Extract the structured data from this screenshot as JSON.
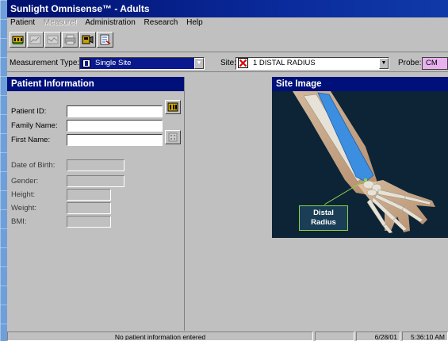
{
  "window": {
    "title": "Sunlight Omnisense™ - Adults"
  },
  "menu": {
    "items": [
      {
        "label": "Patient",
        "enabled": true
      },
      {
        "label": "Measure!",
        "enabled": false
      },
      {
        "label": "Administration",
        "enabled": true
      },
      {
        "label": "Research",
        "enabled": true
      },
      {
        "label": "Help",
        "enabled": true
      }
    ]
  },
  "toolbar": {
    "buttons": [
      {
        "icon": "measure-device-icon",
        "enabled": true
      },
      {
        "icon": "chart-icon",
        "enabled": false
      },
      {
        "icon": "chart-icon",
        "enabled": false
      },
      {
        "icon": "printer-icon",
        "enabled": false
      },
      {
        "icon": "probe-icon",
        "enabled": true
      },
      {
        "icon": "report-icon",
        "enabled": true
      }
    ]
  },
  "selectors": {
    "measurement_type_label": "Measurement Type:",
    "measurement_type_value": "Single Site",
    "site_label": "Site:",
    "site_value": "1  DISTAL RADIUS",
    "probe_label": "Probe:",
    "probe_value": "CM"
  },
  "patient_panel": {
    "title": "Patient Information",
    "patient_id_label": "Patient ID:",
    "family_name_label": "Family Name:",
    "first_name_label": "First Name:",
    "dob_label": "Date of Birth:",
    "gender_label": "Gender:",
    "height_label": "Height:",
    "weight_label": "Weight:",
    "bmi_label": "BMI:"
  },
  "site_panel": {
    "title": "Site Image",
    "callout_line1": "Distal",
    "callout_line2": "Radius"
  },
  "colors": {
    "accent": "#00107a",
    "site_bg": "#0c2435",
    "radius_highlight": "#3c8fe0",
    "callout_border": "#8fd24a"
  },
  "statusbar": {
    "message": "No patient information entered",
    "date": "6/28/01",
    "time": "5:36:10 AM"
  }
}
